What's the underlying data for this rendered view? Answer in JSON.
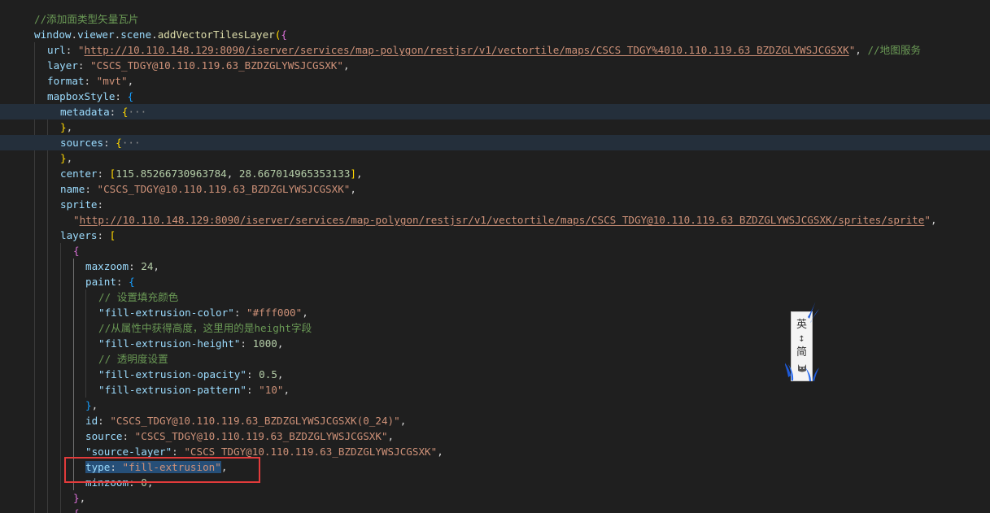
{
  "editor": {
    "lines": [
      {
        "tokens": [
          {
            "t": "//添加面类型矢量瓦片",
            "c": "c"
          }
        ]
      },
      {
        "tokens": [
          {
            "t": "window",
            "c": "k"
          },
          {
            "t": ".",
            "c": "p"
          },
          {
            "t": "viewer",
            "c": "k"
          },
          {
            "t": ".",
            "c": "p"
          },
          {
            "t": "scene",
            "c": "k"
          },
          {
            "t": ".",
            "c": "p"
          },
          {
            "t": "addVectorTilesLayer",
            "c": "f"
          },
          {
            "t": "(",
            "c": "b1"
          },
          {
            "t": "{",
            "c": "b2"
          }
        ]
      },
      {
        "tokens": [
          {
            "t": "url",
            "c": "k"
          },
          {
            "t": ": ",
            "c": "p"
          },
          {
            "t": "\"",
            "c": "s"
          },
          {
            "t": "http://10.110.148.129:8090/iserver/services/map-polygon/restjsr/v1/vectortile/maps/CSCS_TDGY%4010.110.119.63_BZDZGLYWSJCGSXK",
            "c": "u"
          },
          {
            "t": "\"",
            "c": "s"
          },
          {
            "t": ", ",
            "c": "p"
          },
          {
            "t": "//地图服务",
            "c": "c"
          }
        ]
      },
      {
        "tokens": [
          {
            "t": "layer",
            "c": "k"
          },
          {
            "t": ": ",
            "c": "p"
          },
          {
            "t": "\"CSCS_TDGY@10.110.119.63_BZDZGLYWSJCGSXK\"",
            "c": "s"
          },
          {
            "t": ",",
            "c": "p"
          }
        ]
      },
      {
        "tokens": [
          {
            "t": "format",
            "c": "k"
          },
          {
            "t": ": ",
            "c": "p"
          },
          {
            "t": "\"mvt\"",
            "c": "s"
          },
          {
            "t": ",",
            "c": "p"
          }
        ]
      },
      {
        "tokens": [
          {
            "t": "mapboxStyle",
            "c": "k"
          },
          {
            "t": ": ",
            "c": "p"
          },
          {
            "t": "{",
            "c": "b3"
          }
        ]
      },
      {
        "tokens": [
          {
            "t": "metadata",
            "c": "k"
          },
          {
            "t": ": ",
            "c": "p"
          },
          {
            "t": "{",
            "c": "b1"
          },
          {
            "t": "···",
            "c": "fold"
          }
        ]
      },
      {
        "tokens": [
          {
            "t": "}",
            "c": "b1"
          },
          {
            "t": ",",
            "c": "p"
          }
        ]
      },
      {
        "tokens": [
          {
            "t": "sources",
            "c": "k"
          },
          {
            "t": ": ",
            "c": "p"
          },
          {
            "t": "{",
            "c": "b1"
          },
          {
            "t": "···",
            "c": "fold"
          }
        ]
      },
      {
        "tokens": [
          {
            "t": "}",
            "c": "b1"
          },
          {
            "t": ",",
            "c": "p"
          }
        ]
      },
      {
        "tokens": [
          {
            "t": "center",
            "c": "k"
          },
          {
            "t": ": ",
            "c": "p"
          },
          {
            "t": "[",
            "c": "b1"
          },
          {
            "t": "115.85266730963784",
            "c": "n"
          },
          {
            "t": ", ",
            "c": "p"
          },
          {
            "t": "28.667014965353133",
            "c": "n"
          },
          {
            "t": "]",
            "c": "b1"
          },
          {
            "t": ",",
            "c": "p"
          }
        ]
      },
      {
        "tokens": [
          {
            "t": "name",
            "c": "k"
          },
          {
            "t": ": ",
            "c": "p"
          },
          {
            "t": "\"CSCS_TDGY@10.110.119.63_BZDZGLYWSJCGSXK\"",
            "c": "s"
          },
          {
            "t": ",",
            "c": "p"
          }
        ]
      },
      {
        "tokens": [
          {
            "t": "sprite",
            "c": "k"
          },
          {
            "t": ":",
            "c": "p"
          }
        ]
      },
      {
        "tokens": [
          {
            "t": "\"",
            "c": "s"
          },
          {
            "t": "http://10.110.148.129:8090/iserver/services/map-polygon/restjsr/v1/vectortile/maps/CSCS_TDGY@10.110.119.63_BZDZGLYWSJCGSXK/sprites/sprite",
            "c": "u"
          },
          {
            "t": "\"",
            "c": "s"
          },
          {
            "t": ",",
            "c": "p"
          }
        ]
      },
      {
        "tokens": [
          {
            "t": "layers",
            "c": "k"
          },
          {
            "t": ": ",
            "c": "p"
          },
          {
            "t": "[",
            "c": "b1"
          }
        ]
      },
      {
        "tokens": [
          {
            "t": "{",
            "c": "b2"
          }
        ]
      },
      {
        "tokens": [
          {
            "t": "maxzoom",
            "c": "k"
          },
          {
            "t": ": ",
            "c": "p"
          },
          {
            "t": "24",
            "c": "n"
          },
          {
            "t": ",",
            "c": "p"
          }
        ]
      },
      {
        "tokens": [
          {
            "t": "paint",
            "c": "k"
          },
          {
            "t": ": ",
            "c": "p"
          },
          {
            "t": "{",
            "c": "b3"
          }
        ]
      },
      {
        "tokens": [
          {
            "t": "// 设置填充颜色",
            "c": "c"
          }
        ]
      },
      {
        "tokens": [
          {
            "t": "\"fill-extrusion-color\"",
            "c": "k"
          },
          {
            "t": ": ",
            "c": "p"
          },
          {
            "t": "\"#fff000\"",
            "c": "s"
          },
          {
            "t": ",",
            "c": "p"
          }
        ]
      },
      {
        "tokens": [
          {
            "t": "//从属性中获得高度，这里用的是height字段",
            "c": "c"
          }
        ]
      },
      {
        "tokens": [
          {
            "t": "\"fill-extrusion-height\"",
            "c": "k"
          },
          {
            "t": ": ",
            "c": "p"
          },
          {
            "t": "1000",
            "c": "n"
          },
          {
            "t": ",",
            "c": "p"
          }
        ]
      },
      {
        "tokens": [
          {
            "t": "// 透明度设置",
            "c": "c"
          }
        ]
      },
      {
        "tokens": [
          {
            "t": "\"fill-extrusion-opacity\"",
            "c": "k"
          },
          {
            "t": ": ",
            "c": "p"
          },
          {
            "t": "0.5",
            "c": "n"
          },
          {
            "t": ",",
            "c": "p"
          }
        ]
      },
      {
        "tokens": [
          {
            "t": "\"fill-extrusion-pattern\"",
            "c": "k"
          },
          {
            "t": ": ",
            "c": "p"
          },
          {
            "t": "\"10\"",
            "c": "s"
          },
          {
            "t": ",",
            "c": "p"
          }
        ]
      },
      {
        "tokens": [
          {
            "t": "}",
            "c": "b3"
          },
          {
            "t": ",",
            "c": "p"
          }
        ]
      },
      {
        "tokens": [
          {
            "t": "id",
            "c": "k"
          },
          {
            "t": ": ",
            "c": "p"
          },
          {
            "t": "\"CSCS_TDGY@10.110.119.63_BZDZGLYWSJCGSXK(0_24)\"",
            "c": "s"
          },
          {
            "t": ",",
            "c": "p"
          }
        ]
      },
      {
        "tokens": [
          {
            "t": "source",
            "c": "k"
          },
          {
            "t": ": ",
            "c": "p"
          },
          {
            "t": "\"CSCS_TDGY@10.110.119.63_BZDZGLYWSJCGSXK\"",
            "c": "s"
          },
          {
            "t": ",",
            "c": "p"
          }
        ]
      },
      {
        "tokens": [
          {
            "t": "\"source-layer\"",
            "c": "k"
          },
          {
            "t": ": ",
            "c": "p"
          },
          {
            "t": "\"CSCS_TDGY@10.110.119.63_BZDZGLYWSJCGSXK\"",
            "c": "s"
          },
          {
            "t": ",",
            "c": "p"
          }
        ]
      },
      {
        "tokens": [
          {
            "t": "type",
            "c": "k",
            "sel": true
          },
          {
            "t": ": ",
            "c": "p",
            "sel": true
          },
          {
            "t": "\"fill-extrusion\"",
            "c": "s",
            "sel": true
          },
          {
            "t": ",",
            "c": "p"
          }
        ]
      },
      {
        "tokens": [
          {
            "t": "minzoom",
            "c": "k"
          },
          {
            "t": ": ",
            "c": "p"
          },
          {
            "t": "0",
            "c": "n"
          },
          {
            "t": ",",
            "c": "p"
          }
        ]
      },
      {
        "tokens": [
          {
            "t": "}",
            "c": "b2"
          },
          {
            "t": ",",
            "c": "p"
          }
        ]
      },
      {
        "tokens": [
          {
            "t": "{",
            "c": "b2"
          }
        ]
      }
    ]
  },
  "ime": {
    "mode_char_1": "英",
    "separator": "↕",
    "mode_char_2": "简",
    "skin_icon": "cat-icon"
  },
  "annotation": {
    "color": "#e23b3b"
  }
}
